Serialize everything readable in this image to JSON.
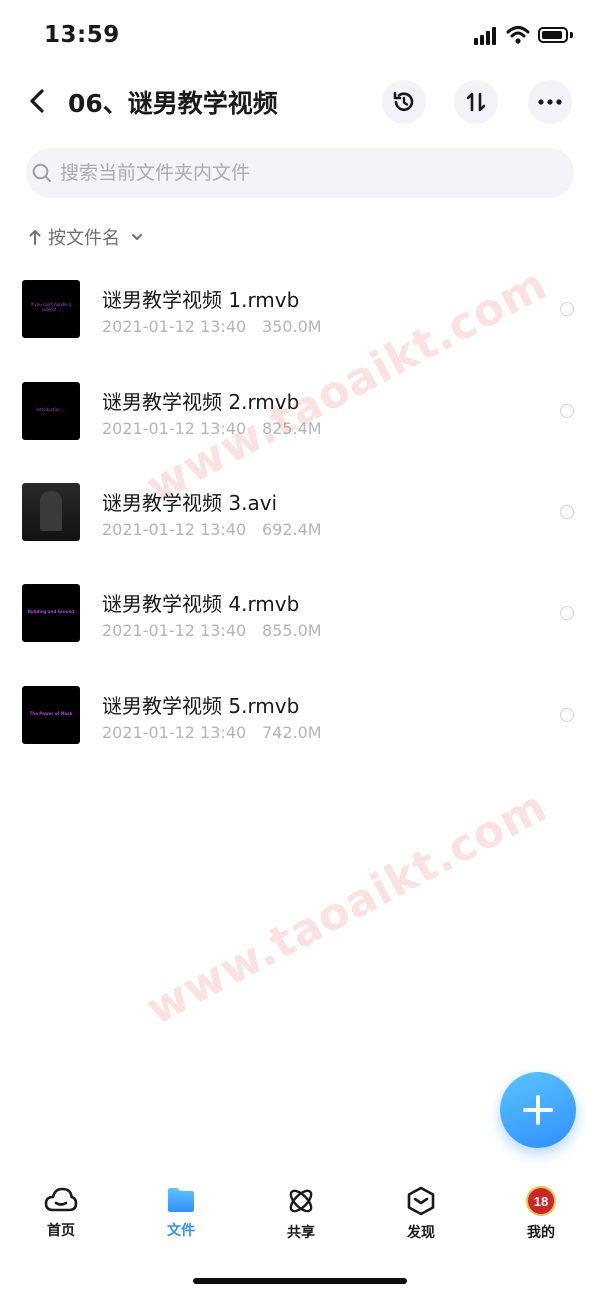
{
  "status_bar": {
    "time": "13:59"
  },
  "header": {
    "title": "06、谜男教学视频"
  },
  "search": {
    "placeholder": "搜索当前文件夹内文件"
  },
  "sort": {
    "label": "按文件名"
  },
  "files": [
    {
      "name": "谜男教学视频 1.rmvb",
      "date": "2021-01-12 13:40",
      "size": "350.0M",
      "thumb_text": "If you can't handle a subject..."
    },
    {
      "name": "谜男教学视频 2.rmvb",
      "date": "2021-01-12 13:40",
      "size": "825.4M",
      "thumb_text": "Introduction ..."
    },
    {
      "name": "谜男教学视频 3.avi",
      "date": "2021-01-12 13:40",
      "size": "692.4M",
      "thumb_text": ""
    },
    {
      "name": "谜男教学视频 4.rmvb",
      "date": "2021-01-12 13:40",
      "size": "855.0M",
      "thumb_text": "Building and Ground"
    },
    {
      "name": "谜男教学视频 5.rmvb",
      "date": "2021-01-12 13:40",
      "size": "742.0M",
      "thumb_text": "The Power of Mask"
    }
  ],
  "watermark": {
    "text": "www.taoaikt.com"
  },
  "tabs": [
    {
      "label": "首页",
      "icon": "cloud-icon"
    },
    {
      "label": "文件",
      "icon": "folder-icon"
    },
    {
      "label": "共享",
      "icon": "atom-icon"
    },
    {
      "label": "发现",
      "icon": "cube-icon"
    },
    {
      "label": "我的",
      "icon": "avatar-icon"
    }
  ],
  "avatar": {
    "badge_text": "18"
  },
  "colors": {
    "accent": "#2f8fff",
    "thumb_text": "#b040e0",
    "watermark": "#eb5a50"
  }
}
